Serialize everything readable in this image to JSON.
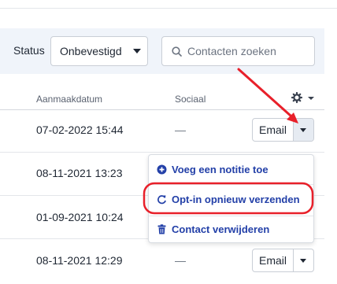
{
  "filters": {
    "status_label": "Status",
    "status_value": "Onbevestigd",
    "search_placeholder": "Contacten zoeken"
  },
  "table": {
    "columns": [
      "Aanmaakdatum",
      "Sociaal"
    ],
    "rows": [
      {
        "date": "07-02-2022 15:44",
        "social": "—",
        "action": "Email"
      },
      {
        "date": "08-11-2021 13:23",
        "social": "",
        "action": ""
      },
      {
        "date": "01-09-2021 10:24",
        "social": "",
        "action": ""
      },
      {
        "date": "08-11-2021 12:29",
        "social": "—",
        "action": "Email"
      }
    ]
  },
  "menu": {
    "items": [
      {
        "label": "Voeg een notitie toe",
        "icon": "plus-circle-icon"
      },
      {
        "label": "Opt-in opnieuw verzenden",
        "icon": "refresh-icon"
      },
      {
        "label": "Contact verwijderen",
        "icon": "trash-icon"
      }
    ]
  },
  "colors": {
    "accent": "#2340a8",
    "annotation": "#e8202a",
    "filter_bg": "#f0f4fa"
  }
}
